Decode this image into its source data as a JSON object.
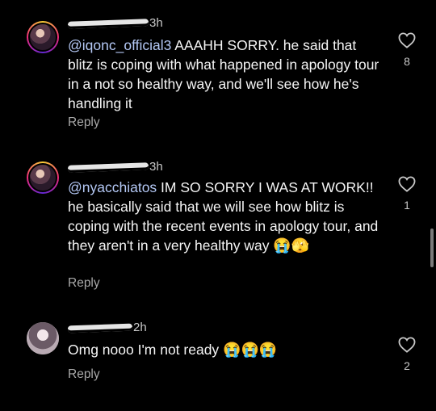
{
  "comments": [
    {
      "time": "3h",
      "mention": "@iqonc_official3",
      "body": " AAAHH SORRY. he said that blitz is coping with what happened in apology tour in a not so healthy way, and we'll see how he's handling it",
      "emoji": "",
      "reply_label": "Reply",
      "likes": "8"
    },
    {
      "time": "3h",
      "mention": "@nyacchiatos",
      "body": " IM SO SORRY I WAS AT WORK!! he basically said that we will see how blitz is coping with the recent events in apology tour, and they aren't in a very healthy way ",
      "emoji": "😭🫣",
      "reply_label": "Reply",
      "likes": "1"
    },
    {
      "time": "2h",
      "mention": "",
      "body": "Omg nooo I'm not ready ",
      "emoji": "😭😭😭",
      "reply_label": "Reply",
      "likes": "2"
    }
  ],
  "colors": {
    "mention": "#b4c8f5",
    "background": "#000000",
    "muted": "#a8a8a8"
  },
  "icons": {
    "like": "heart-outline-icon"
  }
}
